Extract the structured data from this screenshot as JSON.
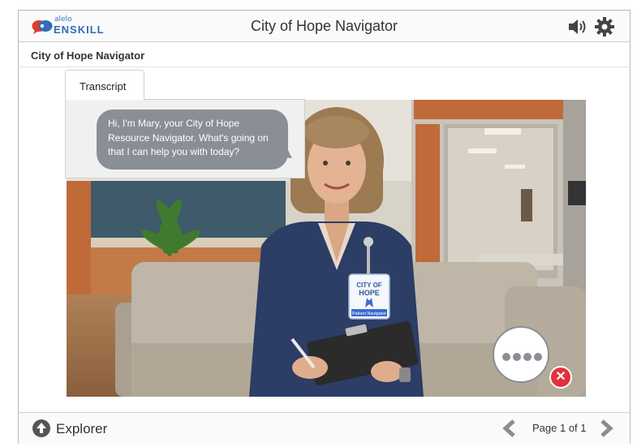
{
  "brand": {
    "small": "alelo",
    "word": "ENSKILL"
  },
  "header": {
    "title": "City of Hope Navigator"
  },
  "subheader": {
    "title": "City of Hope Navigator"
  },
  "transcript": {
    "tab_label": "Transcript",
    "message": "Hi, I'm Mary, your City of Hope Resource Navigator. What's going on that I can help you with today?"
  },
  "badge": {
    "line1": "CITY OF",
    "line2": "HOPE",
    "line3": "Patient Navigator"
  },
  "footer": {
    "explorer_label": "Explorer",
    "page_label": "Page 1 of 1"
  },
  "colors": {
    "accent_red": "#e2313b",
    "bubble_gray": "#8a8f96",
    "blouse": "#2c3d66"
  }
}
